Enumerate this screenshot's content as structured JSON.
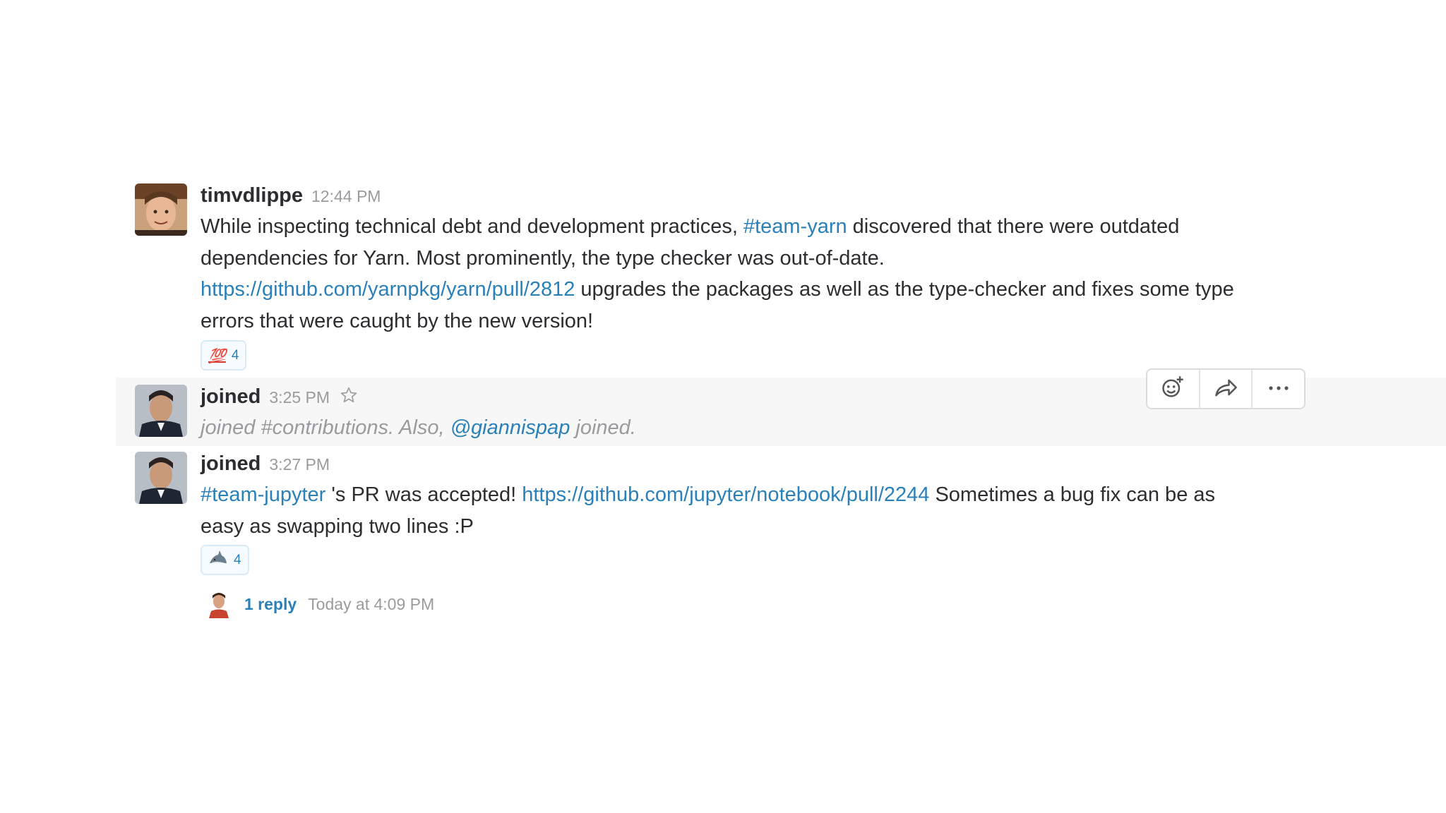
{
  "messages": [
    {
      "author": "timvdlippe",
      "time": "12:44 PM",
      "parts": [
        {
          "t": "While inspecting technical debt and development practices, "
        },
        {
          "t": "#team-yarn",
          "link": true
        },
        {
          "t": " discovered that there were outdated dependencies for Yarn. Most prominently, the type checker was out-of-date. "
        },
        {
          "t": "https://github.com/yarnpkg/yarn/pull/2812",
          "link": true
        },
        {
          "t": " upgrades the packages as well as the type-checker and fixes some type errors that were caught by the new version!"
        }
      ],
      "reaction": {
        "emoji": "💯",
        "count": "4"
      }
    },
    {
      "author": "joined",
      "time": "3:25 PM",
      "parts": [
        {
          "t": "joined #contributions. Also, "
        },
        {
          "t": "@giannispap",
          "link": true
        },
        {
          "t": " joined."
        }
      ]
    },
    {
      "author": "joined",
      "time": "3:27 PM",
      "parts": [
        {
          "t": "#team-jupyter",
          "link": true
        },
        {
          "t": " 's PR was accepted! "
        },
        {
          "t": "https://github.com/jupyter/notebook/pull/2244",
          "link": true
        },
        {
          "t": " Sometimes a bug fix can be as easy as swapping two lines :P"
        }
      ],
      "reaction": {
        "emoji": "shark",
        "count": "4"
      },
      "thread": {
        "replies": "1 reply",
        "last": "Today at 4:09 PM"
      }
    }
  ],
  "hover_actions": [
    "add-reaction-icon",
    "share-icon",
    "more-actions-icon"
  ],
  "colors": {
    "link": "#2a80b9",
    "muted": "#9a9b9e",
    "text": "#2c2d30",
    "hover_bg": "#f7f7f7"
  }
}
